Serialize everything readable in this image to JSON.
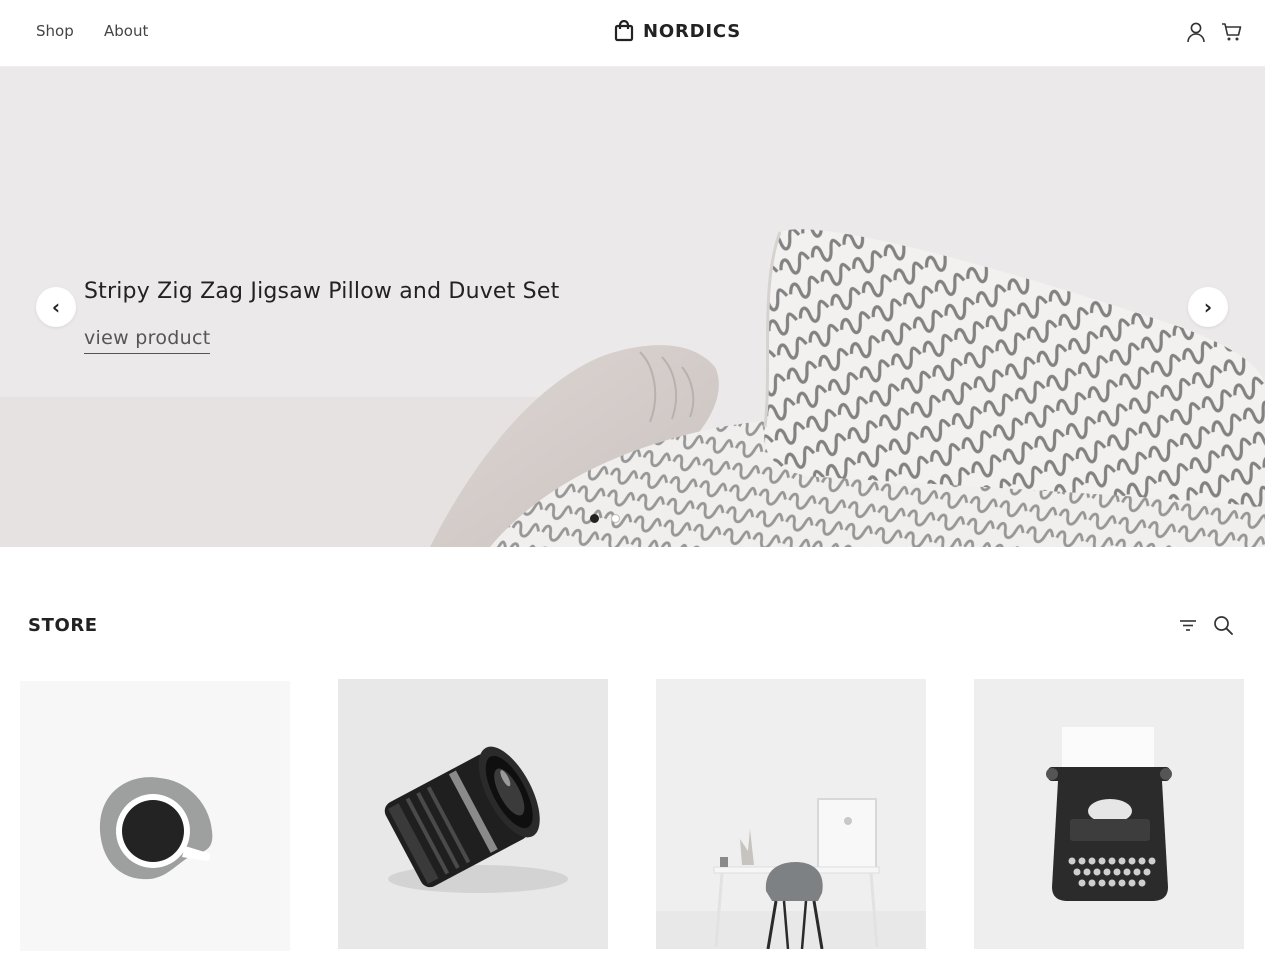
{
  "header": {
    "nav": [
      "Shop",
      "About"
    ],
    "brand": "NORDICS",
    "brand_icon": "shopping-bag-icon",
    "actions": [
      "user-icon",
      "cart-icon"
    ]
  },
  "hero": {
    "title": "Stripy Zig Zag Jigsaw Pillow and Duvet Set",
    "link": "view product",
    "prev": "‹",
    "next": "›",
    "slide_count": 2,
    "active_slide": 1
  },
  "store": {
    "title": "STORE",
    "tools": [
      "filter-icon",
      "search-icon"
    ],
    "products": [
      {
        "image": "coffee-cup"
      },
      {
        "image": "camera-lens"
      },
      {
        "image": "desk-chair"
      },
      {
        "image": "typewriter"
      }
    ]
  }
}
